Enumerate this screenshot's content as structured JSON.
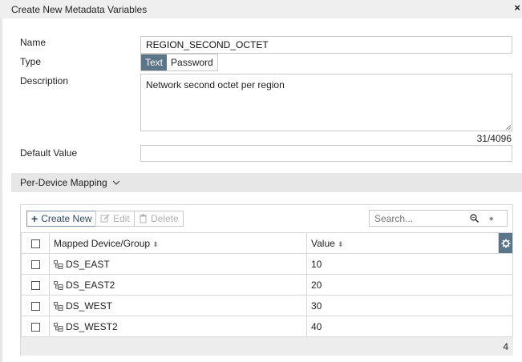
{
  "dialog": {
    "title": "Create New Metadata Variables",
    "close_glyph": "×"
  },
  "form": {
    "name_label": "Name",
    "name_value": "REGION_SECOND_OCTET",
    "type_label": "Type",
    "type_options": [
      "Text",
      "Password"
    ],
    "type_selected": "Text",
    "description_label": "Description",
    "description_value": "Network second octet per region",
    "char_counter": "31/4096",
    "default_value_label": "Default Value",
    "default_value_value": ""
  },
  "mapping": {
    "section_title": "Per-Device Mapping",
    "toolbar": {
      "create_label": "Create New",
      "edit_label": "Edit",
      "delete_label": "Delete",
      "search_placeholder": "Search..."
    },
    "columns": {
      "device": "Mapped Device/Group",
      "value": "Value"
    },
    "rows": [
      {
        "device": "DS_EAST",
        "value": "10"
      },
      {
        "device": "DS_EAST2",
        "value": "20"
      },
      {
        "device": "DS_WEST",
        "value": "30"
      },
      {
        "device": "DS_WEST2",
        "value": "40"
      }
    ],
    "total_count": "4"
  },
  "icons": {
    "close": "close-icon",
    "chevron": "chevron-down-icon",
    "plus": "plus-icon",
    "edit": "edit-icon",
    "delete": "trash-icon",
    "search": "zoom-icon",
    "clear": "asterisk-icon",
    "gear": "gear-icon",
    "device_group": "device-group-icon",
    "sort": "sort-icon"
  },
  "colors": {
    "accent": "#5b7689",
    "section_bg": "#e7e7e7",
    "border": "#d8d8d8"
  }
}
